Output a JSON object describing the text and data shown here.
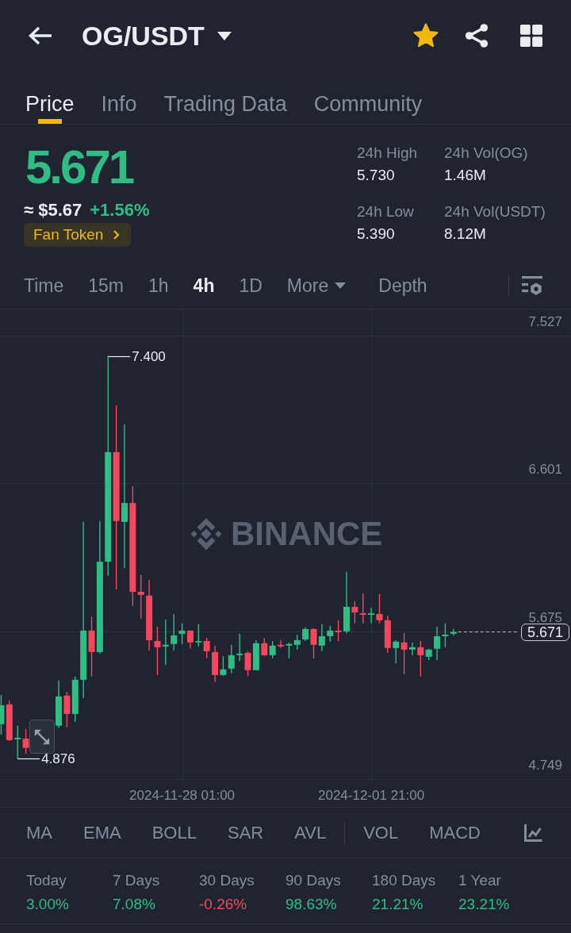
{
  "header": {
    "title": "OG/USDT",
    "favorite": true
  },
  "tabs": [
    {
      "label": "Price",
      "selected": true
    },
    {
      "label": "Info",
      "selected": false
    },
    {
      "label": "Trading Data",
      "selected": false
    },
    {
      "label": "Community",
      "selected": false
    }
  ],
  "ticker": {
    "price": "5.671",
    "rising": true,
    "price_usd": "≈ $5.67",
    "change": "+1.56%",
    "badge": "Fan Token",
    "stats": [
      {
        "label": "24h High",
        "value": "5.730"
      },
      {
        "label": "24h Vol(OG)",
        "value": "1.46M"
      },
      {
        "label": "24h Low",
        "value": "5.390"
      },
      {
        "label": "24h Vol(USDT)",
        "value": "8.12M"
      }
    ]
  },
  "intervals": [
    {
      "label": "Time",
      "kind": "tab",
      "selected": false
    },
    {
      "label": "15m",
      "kind": "tab",
      "selected": false
    },
    {
      "label": "1h",
      "kind": "tab",
      "selected": false
    },
    {
      "label": "4h",
      "kind": "tab",
      "selected": true
    },
    {
      "label": "1D",
      "kind": "tab",
      "selected": false
    },
    {
      "label": "More",
      "kind": "dropdown",
      "selected": false
    },
    {
      "label": "Depth",
      "kind": "tab",
      "selected": false
    }
  ],
  "chart": {
    "watermark": "BINANCE",
    "last_price": "5.671",
    "chart_data": {
      "type": "candlestick",
      "grid": true,
      "categories": [
        null,
        null,
        null,
        null,
        null,
        null,
        null,
        null,
        null,
        null,
        null,
        null,
        null,
        null,
        null,
        null,
        null,
        null,
        null,
        null,
        null,
        null,
        "2024-11-28 01:00",
        null,
        null,
        null,
        null,
        null,
        null,
        null,
        null,
        null,
        null,
        null,
        null,
        null,
        null,
        null,
        null,
        null,
        null,
        null,
        null,
        null,
        null,
        "2024-12-01 21:00",
        null,
        null,
        null,
        null,
        null,
        null,
        null,
        null,
        null,
        null
      ],
      "ohlc": [
        [
          5.093,
          5.277,
          5.028,
          5.212
        ],
        [
          5.217,
          5.242,
          4.988,
          4.993
        ],
        [
          4.998,
          5.083,
          4.876,
          5.008
        ],
        [
          5.003,
          5.063,
          4.909,
          4.944
        ],
        null,
        null,
        null,
        [
          5.083,
          5.366,
          5.068,
          5.267
        ],
        [
          5.272,
          5.297,
          5.073,
          5.157
        ],
        [
          5.157,
          5.391,
          5.108,
          5.371
        ],
        [
          5.371,
          6.36,
          5.257,
          5.679
        ],
        [
          5.679,
          5.768,
          5.391,
          5.545
        ],
        [
          5.545,
          6.365,
          5.535,
          6.111
        ],
        [
          6.111,
          7.4,
          6.022,
          6.797
        ],
        [
          6.797,
          7.09,
          5.937,
          6.365
        ],
        [
          6.36,
          6.971,
          6.072,
          6.479
        ],
        [
          6.479,
          6.583,
          5.833,
          5.922
        ],
        [
          5.922,
          6.027,
          5.754,
          5.903
        ],
        [
          5.898,
          5.997,
          5.555,
          5.619
        ],
        [
          5.614,
          5.704,
          5.401,
          5.575
        ],
        [
          5.58,
          5.749,
          5.465,
          5.59
        ],
        [
          5.595,
          5.783,
          5.555,
          5.649
        ],
        [
          5.659,
          5.724,
          5.595,
          5.679
        ],
        [
          5.679,
          5.679,
          5.57,
          5.605
        ],
        [
          5.605,
          5.719,
          5.58,
          5.614
        ],
        [
          5.614,
          5.634,
          5.505,
          5.55
        ],
        [
          5.545,
          5.585,
          5.356,
          5.401
        ],
        [
          5.401,
          5.52,
          5.396,
          5.436
        ],
        [
          5.441,
          5.59,
          5.411,
          5.525
        ],
        [
          5.525,
          5.659,
          5.49,
          5.535
        ],
        [
          5.54,
          5.55,
          5.396,
          5.431
        ],
        [
          5.431,
          5.619,
          5.431,
          5.6
        ],
        [
          5.6,
          5.634,
          5.52,
          5.525
        ],
        [
          5.525,
          5.614,
          5.505,
          5.585
        ],
        [
          5.59,
          5.619,
          5.57,
          5.58
        ],
        [
          5.585,
          5.605,
          5.505,
          5.595
        ],
        [
          5.59,
          5.654,
          5.56,
          5.619
        ],
        [
          5.624,
          5.699,
          5.614,
          5.689
        ],
        [
          5.689,
          5.694,
          5.505,
          5.59
        ],
        [
          5.585,
          5.719,
          5.55,
          5.644
        ],
        [
          5.644,
          5.709,
          5.61,
          5.679
        ],
        [
          5.679,
          5.744,
          5.614,
          5.669
        ],
        [
          5.674,
          6.047,
          5.664,
          5.828
        ],
        [
          5.828,
          5.863,
          5.724,
          5.793
        ],
        [
          5.788,
          5.913,
          5.724,
          5.778
        ],
        [
          5.778,
          5.823,
          5.724,
          5.788
        ],
        [
          5.783,
          5.908,
          5.724,
          5.744
        ],
        [
          5.744,
          5.773,
          5.54,
          5.57
        ],
        [
          5.57,
          5.619,
          5.475,
          5.61
        ],
        [
          5.605,
          5.664,
          5.406,
          5.56
        ],
        [
          5.56,
          5.605,
          5.525,
          5.575
        ],
        [
          5.575,
          5.614,
          5.391,
          5.525
        ],
        [
          5.515,
          5.565,
          5.495,
          5.56
        ],
        [
          5.565,
          5.704,
          5.495,
          5.644
        ],
        [
          5.644,
          5.724,
          5.575,
          5.654
        ],
        [
          5.659,
          5.689,
          5.649,
          5.671
        ]
      ],
      "ylim": [
        4.749,
        7.527
      ],
      "yticks": [
        7.527,
        6.601,
        5.675,
        4.749
      ],
      "annotations": [
        "7.400",
        "4.876"
      ]
    }
  },
  "indicators": {
    "main": [
      {
        "label": "MA",
        "selected": false
      },
      {
        "label": "EMA",
        "selected": false
      },
      {
        "label": "BOLL",
        "selected": false
      },
      {
        "label": "SAR",
        "selected": false
      },
      {
        "label": "AVL",
        "selected": false
      }
    ],
    "sub": [
      {
        "label": "VOL",
        "selected": false
      },
      {
        "label": "MACD",
        "selected": false
      }
    ]
  },
  "performance": [
    {
      "label": "Today",
      "value": "3.00%",
      "rising": true
    },
    {
      "label": "7 Days",
      "value": "7.08%",
      "rising": true
    },
    {
      "label": "30 Days",
      "value": "-0.26%",
      "rising": false
    },
    {
      "label": "90 Days",
      "value": "98.63%",
      "rising": true
    },
    {
      "label": "180 Days",
      "value": "21.21%",
      "rising": true
    },
    {
      "label": "1 Year",
      "value": "23.21%",
      "rising": true
    }
  ]
}
